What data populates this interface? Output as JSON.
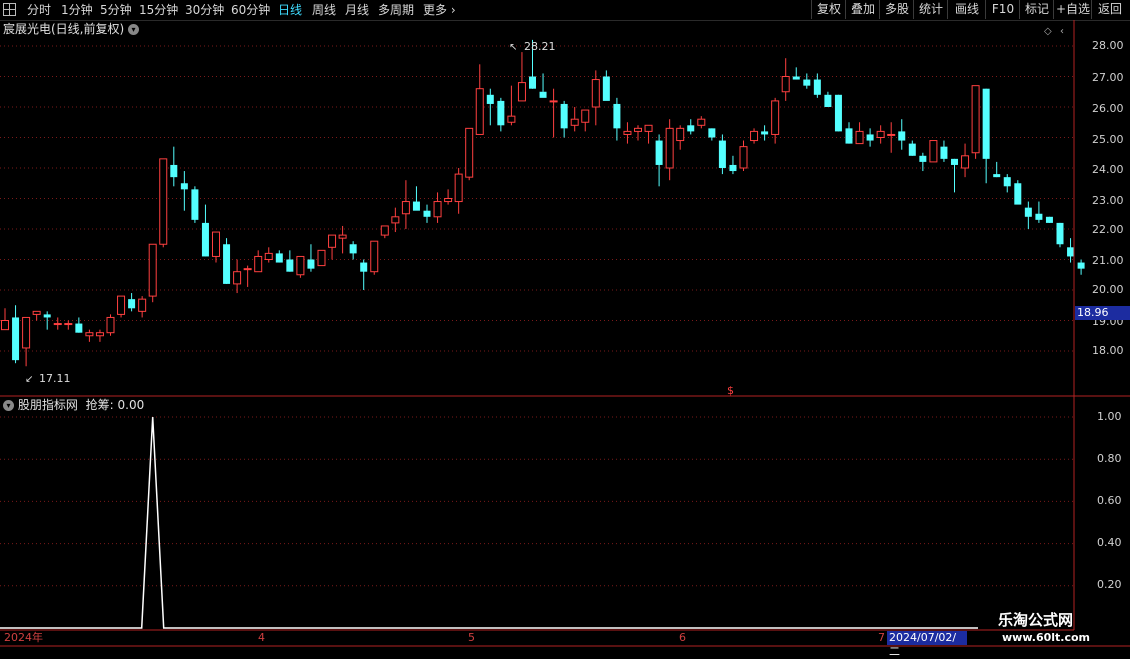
{
  "toolbar": {
    "periods": [
      "分时",
      "1分钟",
      "5分钟",
      "15分钟",
      "30分钟",
      "60分钟",
      "日线",
      "周线",
      "月线",
      "多周期",
      "更多"
    ],
    "active_period": "日线",
    "right_buttons": [
      "复权",
      "叠加",
      "多股",
      "统计",
      "画线",
      "F10",
      "标记",
      "+自选",
      "返回"
    ]
  },
  "main_chart": {
    "stock_title": "宸展光电(日线,前复权)",
    "max_label": "28.21",
    "min_label": "17.11",
    "current_price": "18.96",
    "y_ticks": [
      "28.00",
      "27.00",
      "26.00",
      "25.00",
      "24.00",
      "23.00",
      "22.00",
      "21.00",
      "20.00",
      "19.00",
      "18.00"
    ],
    "marker": "$"
  },
  "indicator": {
    "title": "股朋指标网",
    "series_label": "抢筹:",
    "series_value": "0.00",
    "y_ticks": [
      "1.00",
      "0.80",
      "0.60",
      "0.40",
      "0.20"
    ]
  },
  "x_axis": {
    "labels": [
      "2024年",
      "4",
      "5",
      "6",
      "7"
    ],
    "date_box": "2024/07/02/二"
  },
  "watermark": {
    "title": "乐淘公式网",
    "url": "www.60lt.com"
  },
  "colors": {
    "up": "#ff4040",
    "down": "#54ffff",
    "grid": "#7a1a1a",
    "axis": "#b22222",
    "active": "#3fdcff"
  },
  "chart_data": {
    "type": "candlestick",
    "y_range": [
      17,
      28.4
    ],
    "candles": [
      [
        18.7,
        19.4,
        18.8,
        19.0
      ],
      [
        19.1,
        19.5,
        17.6,
        17.7
      ],
      [
        18.1,
        19.1,
        17.5,
        19.1
      ],
      [
        19.2,
        19.3,
        19.0,
        19.3
      ],
      [
        19.2,
        19.3,
        18.7,
        19.1
      ],
      [
        18.9,
        19.1,
        18.7,
        18.9
      ],
      [
        18.9,
        19.0,
        18.7,
        18.9
      ],
      [
        18.9,
        19.1,
        18.6,
        18.6
      ],
      [
        18.5,
        18.7,
        18.3,
        18.6
      ],
      [
        18.5,
        18.7,
        18.3,
        18.6
      ],
      [
        18.6,
        19.2,
        18.5,
        19.1
      ],
      [
        19.2,
        19.8,
        19.1,
        19.8
      ],
      [
        19.7,
        19.9,
        19.3,
        19.4
      ],
      [
        19.3,
        19.8,
        19.1,
        19.7
      ],
      [
        19.8,
        21.5,
        19.6,
        21.5
      ],
      [
        21.5,
        24.3,
        21.4,
        24.3
      ],
      [
        24.1,
        24.7,
        23.4,
        23.7
      ],
      [
        23.5,
        23.9,
        22.6,
        23.3
      ],
      [
        23.3,
        23.4,
        22.2,
        22.3
      ],
      [
        22.2,
        22.8,
        21.1,
        21.1
      ],
      [
        21.1,
        21.8,
        20.9,
        21.9
      ],
      [
        21.5,
        21.7,
        20.2,
        20.2
      ],
      [
        20.2,
        21.0,
        19.9,
        20.6
      ],
      [
        20.7,
        20.8,
        20.1,
        20.7
      ],
      [
        20.6,
        21.3,
        20.6,
        21.1
      ],
      [
        21.0,
        21.4,
        20.9,
        21.2
      ],
      [
        21.2,
        21.3,
        20.9,
        20.9
      ],
      [
        21.0,
        21.3,
        20.6,
        20.6
      ],
      [
        20.5,
        21.1,
        20.4,
        21.1
      ],
      [
        21.0,
        21.5,
        20.6,
        20.7
      ],
      [
        20.8,
        21.2,
        20.8,
        21.3
      ],
      [
        21.4,
        21.7,
        21.0,
        21.8
      ],
      [
        21.7,
        22.1,
        21.2,
        21.8
      ],
      [
        21.5,
        21.6,
        21.0,
        21.2
      ],
      [
        20.9,
        21.0,
        20.0,
        20.6
      ],
      [
        20.6,
        21.6,
        20.5,
        21.6
      ],
      [
        21.8,
        22.1,
        21.7,
        22.1
      ],
      [
        22.2,
        22.7,
        21.9,
        22.4
      ],
      [
        22.5,
        23.6,
        22.0,
        22.9
      ],
      [
        22.9,
        23.4,
        22.7,
        22.6
      ],
      [
        22.6,
        22.8,
        22.2,
        22.4
      ],
      [
        22.4,
        23.2,
        22.2,
        22.9
      ],
      [
        22.9,
        23.3,
        22.8,
        23.0
      ],
      [
        22.9,
        24.0,
        22.5,
        23.8
      ],
      [
        23.7,
        25.3,
        23.6,
        25.3
      ],
      [
        25.1,
        27.4,
        25.2,
        26.6
      ],
      [
        26.4,
        26.6,
        25.4,
        26.1
      ],
      [
        26.2,
        26.3,
        25.2,
        25.4
      ],
      [
        25.5,
        26.7,
        25.4,
        25.7
      ],
      [
        26.2,
        27.8,
        26.2,
        26.8
      ],
      [
        27.0,
        28.2,
        26.6,
        26.6
      ],
      [
        26.5,
        27.1,
        26.5,
        26.3
      ],
      [
        26.2,
        26.6,
        25.0,
        26.2
      ],
      [
        26.1,
        26.2,
        25.0,
        25.3
      ],
      [
        25.4,
        26.0,
        25.2,
        25.6
      ],
      [
        25.5,
        25.9,
        25.2,
        25.9
      ],
      [
        26.0,
        27.2,
        25.4,
        26.9
      ],
      [
        27.0,
        27.2,
        26.6,
        26.2
      ],
      [
        26.1,
        26.3,
        24.9,
        25.3
      ],
      [
        25.1,
        25.5,
        24.8,
        25.2
      ],
      [
        25.2,
        25.4,
        24.9,
        25.3
      ],
      [
        25.2,
        25.4,
        24.8,
        25.4
      ],
      [
        24.9,
        25.1,
        23.4,
        24.1
      ],
      [
        24.0,
        25.6,
        23.6,
        25.3
      ],
      [
        24.9,
        25.4,
        24.6,
        25.3
      ],
      [
        25.4,
        25.6,
        25.1,
        25.2
      ],
      [
        25.4,
        25.7,
        25.3,
        25.6
      ],
      [
        25.3,
        25.3,
        24.9,
        25.0
      ],
      [
        24.9,
        25.1,
        23.8,
        24.0
      ],
      [
        24.1,
        24.4,
        23.8,
        23.9
      ],
      [
        24.0,
        24.9,
        23.9,
        24.7
      ],
      [
        24.9,
        25.3,
        24.8,
        25.2
      ],
      [
        25.2,
        25.4,
        24.9,
        25.1
      ],
      [
        25.1,
        26.3,
        24.8,
        26.2
      ],
      [
        26.5,
        27.6,
        26.2,
        27.0
      ],
      [
        27.0,
        27.3,
        26.9,
        26.9
      ],
      [
        26.9,
        27.1,
        26.6,
        26.7
      ],
      [
        26.9,
        27.1,
        26.3,
        26.4
      ],
      [
        26.4,
        26.5,
        26.0,
        26.0
      ],
      [
        26.4,
        26.4,
        25.2,
        25.2
      ],
      [
        25.3,
        25.5,
        24.8,
        24.8
      ],
      [
        24.8,
        25.5,
        24.9,
        25.2
      ],
      [
        25.1,
        25.3,
        24.7,
        24.9
      ],
      [
        25.0,
        25.4,
        24.8,
        25.2
      ],
      [
        25.1,
        25.5,
        24.5,
        25.1
      ],
      [
        25.2,
        25.6,
        24.6,
        24.9
      ],
      [
        24.8,
        24.9,
        24.4,
        24.4
      ],
      [
        24.4,
        24.5,
        23.9,
        24.2
      ],
      [
        24.2,
        24.9,
        24.2,
        24.9
      ],
      [
        24.7,
        24.9,
        24.2,
        24.3
      ],
      [
        24.3,
        24.3,
        23.2,
        24.1
      ],
      [
        24.0,
        24.8,
        23.7,
        24.4
      ],
      [
        24.5,
        26.7,
        24.3,
        26.7
      ],
      [
        26.6,
        26.6,
        23.5,
        24.3
      ],
      [
        23.8,
        24.2,
        23.7,
        23.7
      ],
      [
        23.7,
        23.8,
        23.2,
        23.4
      ],
      [
        23.5,
        23.6,
        22.9,
        22.8
      ],
      [
        22.7,
        22.9,
        22.0,
        22.4
      ],
      [
        22.5,
        22.9,
        22.2,
        22.3
      ],
      [
        22.4,
        22.4,
        22.2,
        22.2
      ],
      [
        22.2,
        22.2,
        21.4,
        21.5
      ],
      [
        21.4,
        21.7,
        20.9,
        21.1
      ],
      [
        20.9,
        21.0,
        20.5,
        20.7
      ]
    ],
    "indicator_series": {
      "name": "抢筹",
      "spike_index": 14,
      "spike_value": 1.0,
      "baseline": 0.0,
      "y_range": [
        0,
        1.05
      ]
    }
  }
}
